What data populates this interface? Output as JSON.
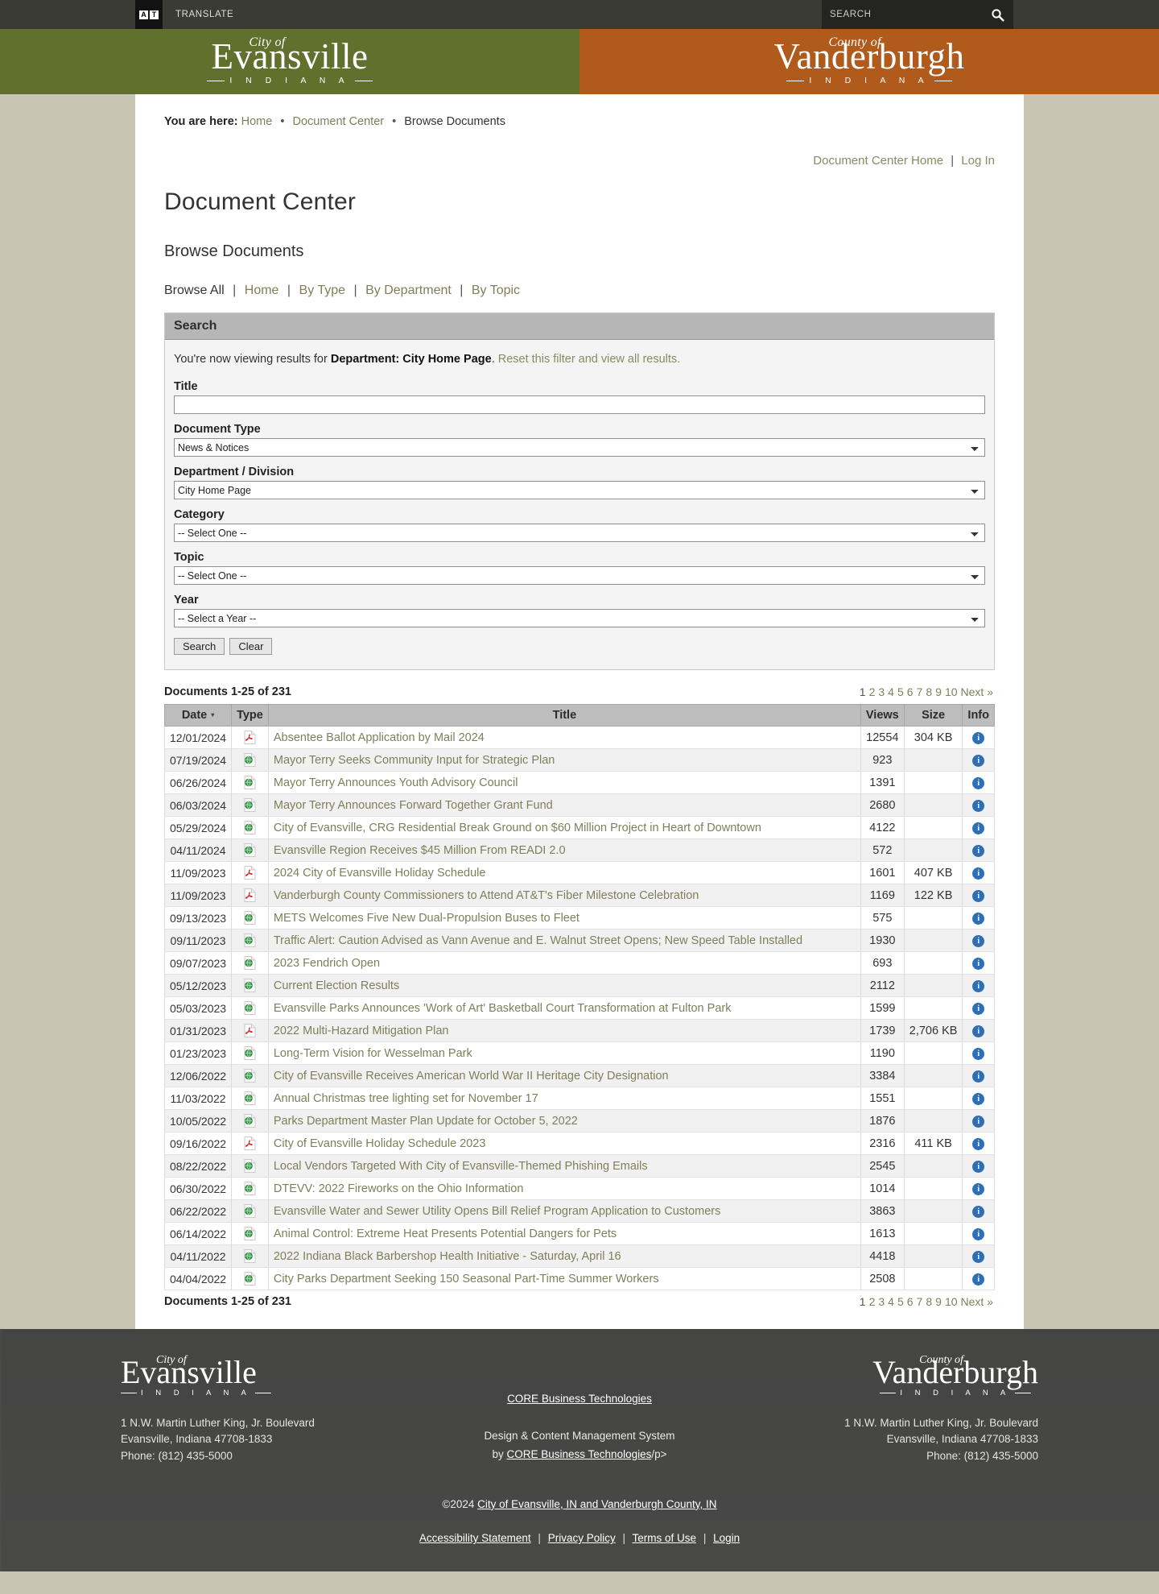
{
  "topbar": {
    "a11y_icon": "accessibility-icon",
    "a11y_letters": [
      "A",
      "T"
    ],
    "translate_label": "TRANSLATE",
    "search_placeholder": "SEARCH",
    "search_value": "",
    "search_icon": "search-icon"
  },
  "brand": {
    "city": {
      "pre": "City of",
      "main": "Evansville",
      "sub": "I N D I A N A",
      "color": "#62702e"
    },
    "county": {
      "pre": "County of",
      "main": "Vanderburgh",
      "sub": "I N D I A N A",
      "color": "#b05a1c"
    }
  },
  "breadcrumb": {
    "prefix": "You are here:",
    "items": [
      {
        "label": "Home",
        "link": true
      },
      {
        "label": "Document Center",
        "link": true
      },
      {
        "label": "Browse Documents",
        "link": false
      }
    ],
    "separator": "•"
  },
  "header_links": {
    "home": "Document Center Home",
    "login": "Log In",
    "divider": "|"
  },
  "page_title": "Document Center",
  "section_title": "Browse Documents",
  "browse_nav": {
    "current": "Browse All",
    "items": [
      "Home",
      "By Type",
      "By Department",
      "By Topic"
    ],
    "divider": "|"
  },
  "search_panel": {
    "heading": "Search",
    "filter_note_prefix": "You're now viewing results for ",
    "filter_note_bold": "Department: City Home Page",
    "filter_note_suffix": ". ",
    "filter_note_link": "Reset this filter and view all results.",
    "fields": {
      "title": {
        "label": "Title",
        "value": "",
        "placeholder": ""
      },
      "document_type": {
        "label": "Document Type",
        "value": "News & Notices"
      },
      "department": {
        "label": "Department / Division",
        "value": "City Home Page"
      },
      "category": {
        "label": "Category",
        "value": "-- Select One --"
      },
      "topic": {
        "label": "Topic",
        "value": "-- Select One --"
      },
      "year": {
        "label": "Year",
        "value": "-- Select a Year --"
      }
    },
    "buttons": {
      "search": "Search",
      "clear": "Clear"
    }
  },
  "results": {
    "count_label": "Documents 1-25 of 231",
    "pager": [
      "1",
      "2",
      "3",
      "4",
      "5",
      "6",
      "7",
      "8",
      "9",
      "10",
      "Next »"
    ],
    "columns": [
      "Date",
      "Type",
      "Title",
      "Views",
      "Size",
      "Info"
    ],
    "sort_column": "Date",
    "sort_caret": "▾",
    "rows": [
      {
        "date": "12/01/2024",
        "type": "pdf",
        "title": "Absentee Ballot Application by Mail 2024",
        "views": "12554",
        "size": "304 KB",
        "info": "i"
      },
      {
        "date": "07/19/2024",
        "type": "web",
        "title": "Mayor Terry Seeks Community Input for Strategic Plan",
        "views": "923",
        "size": "",
        "info": "i"
      },
      {
        "date": "06/26/2024",
        "type": "web",
        "title": "Mayor Terry Announces Youth Advisory Council",
        "views": "1391",
        "size": "",
        "info": "i"
      },
      {
        "date": "06/03/2024",
        "type": "web",
        "title": "Mayor Terry Announces Forward Together Grant Fund",
        "views": "2680",
        "size": "",
        "info": "i"
      },
      {
        "date": "05/29/2024",
        "type": "web",
        "title": "City of Evansville, CRG Residential Break Ground on $60 Million Project in Heart of Downtown",
        "views": "4122",
        "size": "",
        "info": "i"
      },
      {
        "date": "04/11/2024",
        "type": "web",
        "title": "Evansville Region Receives $45 Million From READI 2.0",
        "views": "572",
        "size": "",
        "info": "i"
      },
      {
        "date": "11/09/2023",
        "type": "pdf",
        "title": "2024 City of Evansville Holiday Schedule",
        "views": "1601",
        "size": "407 KB",
        "info": "i"
      },
      {
        "date": "11/09/2023",
        "type": "pdf",
        "title": "Vanderburgh County Commissioners to Attend AT&T's Fiber Milestone Celebration",
        "views": "1169",
        "size": "122 KB",
        "info": "i"
      },
      {
        "date": "09/13/2023",
        "type": "web",
        "title": "METS Welcomes Five New Dual-Propulsion Buses to Fleet",
        "views": "575",
        "size": "",
        "info": "i"
      },
      {
        "date": "09/11/2023",
        "type": "web",
        "title": "Traffic Alert: Caution Advised as Vann Avenue and E. Walnut Street Opens; New Speed Table Installed",
        "views": "1930",
        "size": "",
        "info": "i"
      },
      {
        "date": "09/07/2023",
        "type": "web",
        "title": "2023 Fendrich Open",
        "views": "693",
        "size": "",
        "info": "i"
      },
      {
        "date": "05/12/2023",
        "type": "web",
        "title": "Current Election Results",
        "views": "2112",
        "size": "",
        "info": "i"
      },
      {
        "date": "05/03/2023",
        "type": "web",
        "title": "Evansville Parks Announces 'Work of Art' Basketball Court Transformation at Fulton Park",
        "views": "1599",
        "size": "",
        "info": "i"
      },
      {
        "date": "01/31/2023",
        "type": "pdf",
        "title": "2022 Multi-Hazard Mitigation Plan",
        "views": "1739",
        "size": "2,706 KB",
        "info": "i"
      },
      {
        "date": "01/23/2023",
        "type": "web",
        "title": "Long-Term Vision for Wesselman Park",
        "views": "1190",
        "size": "",
        "info": "i"
      },
      {
        "date": "12/06/2022",
        "type": "web",
        "title": "City of Evansville Receives American World War II Heritage City Designation",
        "views": "3384",
        "size": "",
        "info": "i"
      },
      {
        "date": "11/03/2022",
        "type": "web",
        "title": "Annual Christmas tree lighting set for November 17",
        "views": "1551",
        "size": "",
        "info": "i"
      },
      {
        "date": "10/05/2022",
        "type": "web",
        "title": "Parks Department Master Plan Update for October 5, 2022",
        "views": "1876",
        "size": "",
        "info": "i"
      },
      {
        "date": "09/16/2022",
        "type": "pdf",
        "title": "City of Evansville Holiday Schedule 2023",
        "views": "2316",
        "size": "411 KB",
        "info": "i"
      },
      {
        "date": "08/22/2022",
        "type": "web",
        "title": "Local Vendors Targeted With City of Evansville-Themed Phishing Emails",
        "views": "2545",
        "size": "",
        "info": "i"
      },
      {
        "date": "06/30/2022",
        "type": "web",
        "title": "DTEVV: 2022 Fireworks on the Ohio Information",
        "views": "1014",
        "size": "",
        "info": "i"
      },
      {
        "date": "06/22/2022",
        "type": "web",
        "title": "Evansville Water and Sewer Utility Opens Bill Relief Program Application to Customers",
        "views": "3863",
        "size": "",
        "info": "i"
      },
      {
        "date": "06/14/2022",
        "type": "web",
        "title": "Animal Control: Extreme Heat Presents Potential Dangers for Pets",
        "views": "1613",
        "size": "",
        "info": "i"
      },
      {
        "date": "04/11/2022",
        "type": "web",
        "title": "2022 Indiana Black Barbershop Health Initiative - Saturday, April 16",
        "views": "4418",
        "size": "",
        "info": "i"
      },
      {
        "date": "04/04/2022",
        "type": "web",
        "title": "City Parks Department Seeking 150 Seasonal Part-Time Summer Workers",
        "views": "2508",
        "size": "",
        "info": "i"
      }
    ]
  },
  "footer": {
    "city": {
      "pre": "City of",
      "main": "Evansville",
      "sub": "I N D I A N A",
      "address1": "1 N.W. Martin Luther King, Jr. Boulevard",
      "address2": "Evansville, Indiana 47708-1833",
      "phone": "Phone: (812) 435-5000"
    },
    "county": {
      "pre": "County of",
      "main": "Vanderburgh",
      "sub": "I N D I A N A",
      "address1": "1 N.W. Martin Luther King, Jr. Boulevard",
      "address2": "Evansville, Indiana 47708-1833",
      "phone": "Phone: (812) 435-5000"
    },
    "middle": {
      "core_link": "CORE Business Technologies",
      "design_line": "Design & Content Management System",
      "by_text": "by ",
      "by_link": "CORE Business Technologies",
      "by_suffix": "/p>",
      "copyright_prefix": "©2024 ",
      "copyright_link": "City of Evansville, IN and Vanderburgh County, IN",
      "links": [
        "Accessibility Statement",
        "Privacy Policy",
        "Terms of Use",
        "Login"
      ],
      "divider": "|"
    }
  }
}
